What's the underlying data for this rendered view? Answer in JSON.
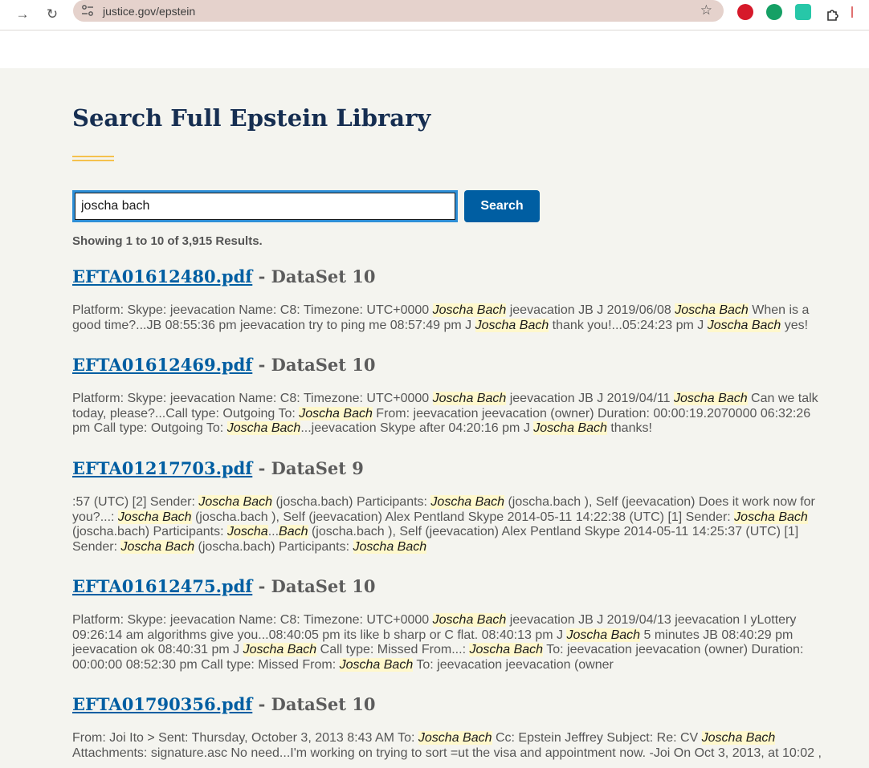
{
  "browser": {
    "url": "justice.gov/epstein"
  },
  "page": {
    "title": "Search Full Epstein Library",
    "search_value": "joscha bach",
    "search_button": "Search",
    "results_summary": "Showing 1 to 10 of 3,915 Results."
  },
  "results": [
    {
      "file": "EFTA01612480.pdf",
      "dataset": "- DataSet 10",
      "snippet": [
        {
          "t": "Platform: Skype: jeevacation Name: C8: Timezone: UTC+0000 "
        },
        {
          "h": "Joscha Bach"
        },
        {
          "t": " jeevacation JB J 2019/06/08 "
        },
        {
          "h": "Joscha Bach"
        },
        {
          "t": " When is a good time?...JB 08:55:36 pm jeevacation try to ping me 08:57:49 pm J "
        },
        {
          "h": "Joscha Bach"
        },
        {
          "t": " thank you!...05:24:23 pm J "
        },
        {
          "h": "Joscha Bach"
        },
        {
          "t": " yes!"
        }
      ]
    },
    {
      "file": "EFTA01612469.pdf",
      "dataset": "- DataSet 10",
      "snippet": [
        {
          "t": "Platform: Skype: jeevacation Name: C8: Timezone: UTC+0000 "
        },
        {
          "h": "Joscha Bach"
        },
        {
          "t": " jeevacation JB J 2019/04/11 "
        },
        {
          "h": "Joscha Bach"
        },
        {
          "t": " Can we talk today, please?...Call type: Outgoing To: "
        },
        {
          "h": "Joscha Bach"
        },
        {
          "t": " From: jeevacation jeevacation (owner) Duration: 00:00:19.2070000 06:32:26 pm Call type: Outgoing To: "
        },
        {
          "h": "Joscha Bach"
        },
        {
          "t": "...jeevacation Skype after 04:20:16 pm J "
        },
        {
          "h": "Joscha Bach"
        },
        {
          "t": " thanks!"
        }
      ]
    },
    {
      "file": "EFTA01217703.pdf",
      "dataset": "- DataSet 9",
      "snippet": [
        {
          "t": ":57 (UTC) [2] Sender: "
        },
        {
          "h": "Joscha Bach"
        },
        {
          "t": " (joscha.bach) Participants: "
        },
        {
          "h": "Joscha Bach"
        },
        {
          "t": " (joscha.bach ), Self (jeevacation) Does it work now for you?...: "
        },
        {
          "h": "Joscha Bach"
        },
        {
          "t": " (joscha.bach ), Self (jeevacation) Alex Pentland Skype 2014-05-11 14:22:38 (UTC) [1] Sender: "
        },
        {
          "h": "Joscha Bach"
        },
        {
          "t": " (joscha.bach) Participants: "
        },
        {
          "h": "Joscha"
        },
        {
          "t": "..."
        },
        {
          "h": "Bach"
        },
        {
          "t": " (joscha.bach ), Self (jeevacation) Alex Pentland Skype 2014-05-11 14:25:37 (UTC) [1] Sender: "
        },
        {
          "h": "Joscha Bach"
        },
        {
          "t": " (joscha.bach) Participants: "
        },
        {
          "h": "Joscha Bach"
        }
      ]
    },
    {
      "file": "EFTA01612475.pdf",
      "dataset": "- DataSet 10",
      "snippet": [
        {
          "t": "Platform: Skype: jeevacation Name: C8: Timezone: UTC+0000 "
        },
        {
          "h": "Joscha Bach"
        },
        {
          "t": " jeevacation JB J 2019/04/13 jeevacation I yLottery 09:26:14 am algorithms give you...08:40:05 pm its like b sharp or C flat. 08:40:13 pm J "
        },
        {
          "h": "Joscha Bach"
        },
        {
          "t": " 5 minutes JB 08:40:29 pm jeevacation ok 08:40:31 pm J "
        },
        {
          "h": "Joscha Bach"
        },
        {
          "t": " Call type: Missed From...: "
        },
        {
          "h": "Joscha Bach"
        },
        {
          "t": " To: jeevacation jeevacation (owner) Duration: 00:00:00 08:52:30 pm Call type: Missed From: "
        },
        {
          "h": "Joscha Bach"
        },
        {
          "t": " To: jeevacation jeevacation (owner"
        }
      ]
    },
    {
      "file": "EFTA01790356.pdf",
      "dataset": "- DataSet 10",
      "snippet": [
        {
          "t": "From: Joi Ito > Sent: Thursday, October 3, 2013 8:43 AM To: "
        },
        {
          "h": "Joscha Bach"
        },
        {
          "t": " Cc: Epstein Jeffrey Subject: Re: CV "
        },
        {
          "h": "Joscha Bach"
        },
        {
          "t": " Attachments: signature.asc No need...I'm working on trying to sort =ut the visa and appointment now. -Joi On Oct 3, 2013, at 10:02 ,"
        }
      ]
    }
  ],
  "colors": {
    "title": "#162e51",
    "link": "#005ea2",
    "accent": "#f5c14d",
    "highlight": "#fff8cc",
    "background": "#f4f4ef"
  },
  "icons": {
    "forward": "arrow-right",
    "reload": "reload",
    "site_settings": "tune",
    "bookmark": "star",
    "extensions": "puzzle"
  }
}
